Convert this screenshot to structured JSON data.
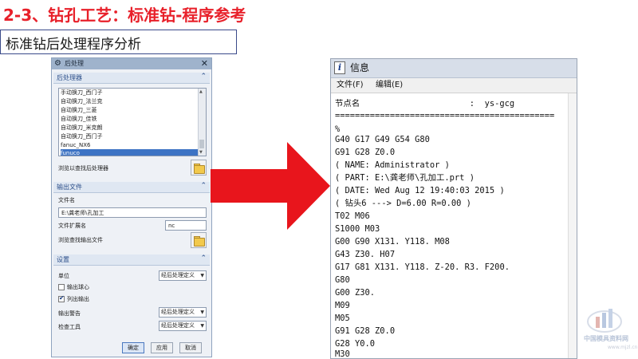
{
  "slide": {
    "title": "2-3、钻孔工艺：标准钻-程序参考",
    "subtitle": "标准钻后处理程序分析"
  },
  "dialog": {
    "title": "后处理",
    "section_postprocessor": {
      "title": "后处理器",
      "items": [
        "手动换刀_西门子",
        "自动换刀_法兰克",
        "自动换刀_三菱",
        "自动换刀_佳铁",
        "自动换刀_米克朗",
        "自动换刀_西门子",
        "fanuc_NX6",
        "funuco"
      ],
      "selected_index": 7,
      "browse_label": "浏览以查找后处理器"
    },
    "section_output": {
      "title": "输出文件",
      "filename_label": "文件名",
      "filename_value": "E:\\龚老师\\孔加工",
      "ext_label": "文件扩展名",
      "ext_value": "nc",
      "browse_label": "浏览查找输出文件"
    },
    "section_settings": {
      "title": "设置",
      "unit_label": "单位",
      "unit_value": "经后处理定义",
      "output_ball_center_label": "输出球心",
      "output_ball_center_checked": false,
      "list_output_label": "列出输出",
      "list_output_checked": true,
      "output_warning_label": "输出警告",
      "output_warning_value": "经后处理定义",
      "check_tool_label": "检查工具",
      "check_tool_value": "经后处理定义"
    },
    "buttons": {
      "ok": "确定",
      "apply": "应用",
      "cancel": "取消"
    }
  },
  "info_window": {
    "title": "信息",
    "menu": {
      "file": "文件(F)",
      "edit": "编辑(E)"
    },
    "lines": [
      "节点名                      :  ys-gcg",
      "============================================",
      "%",
      "G40 G17 G49 G54 G80",
      "G91 G28 Z0.0",
      "( NAME: Administrator )",
      "( PART: E:\\龚老师\\孔加工.prt )",
      "( DATE: Wed Aug 12 19:40:03 2015 )",
      "( 钻头6 ---> D=6.00 R=0.00 )",
      "T02 M06",
      "S1000 M03",
      "G00 G90 X131. Y118. M08",
      "G43 Z30. H07",
      "G17 G81 X131. Y118. Z-20. R3. F200.",
      "G80",
      "G00 Z30.",
      "M09",
      "M05",
      "G91 G28 Z0.0",
      "G28 Y0.0",
      "M30",
      "%"
    ]
  },
  "watermark": {
    "text": "中国模具资料网",
    "url": "www.mjzl.cn"
  },
  "colors": {
    "title_red": "#e8202a",
    "arrow_red": "#e8151c",
    "selection_blue": "#3d73c4",
    "section_blue": "#2c4f8a"
  },
  "icons": {
    "dialog_gear": "gear-icon",
    "collapse": "chevron-up-icon",
    "folder": "folder-icon",
    "info": "info-icon",
    "dropdown": "chevron-down-icon"
  }
}
